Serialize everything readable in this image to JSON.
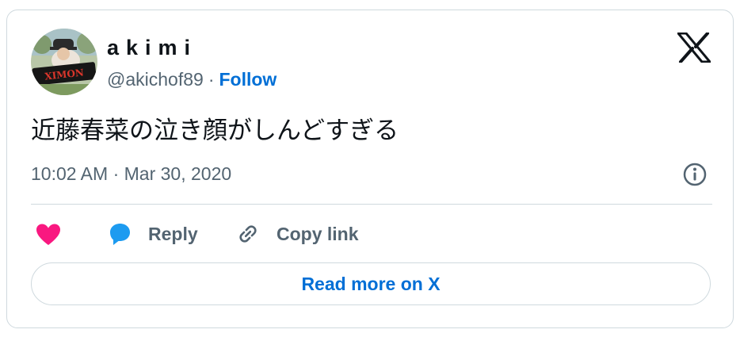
{
  "author": {
    "display_name": "akimi",
    "handle": "@akichof89",
    "separator": "·",
    "follow_label": "Follow",
    "avatar_banner_text": "XIMON"
  },
  "tweet": {
    "text": "近藤春菜の泣き顔がしんどすぎる",
    "timestamp": "10:02 AM · Mar 30, 2020"
  },
  "actions": {
    "reply_label": "Reply",
    "copy_link_label": "Copy link"
  },
  "read_more_label": "Read more on X",
  "icons": {
    "brand": "x-logo-icon",
    "info": "info-icon",
    "like": "heart-icon",
    "reply": "speech-bubble-icon",
    "copy": "link-icon"
  },
  "colors": {
    "accent": "#006fd6",
    "heart": "#f91880",
    "reply": "#1d9bf0",
    "text": "#0f1419",
    "secondary": "#536471",
    "border": "#cfd9de"
  }
}
